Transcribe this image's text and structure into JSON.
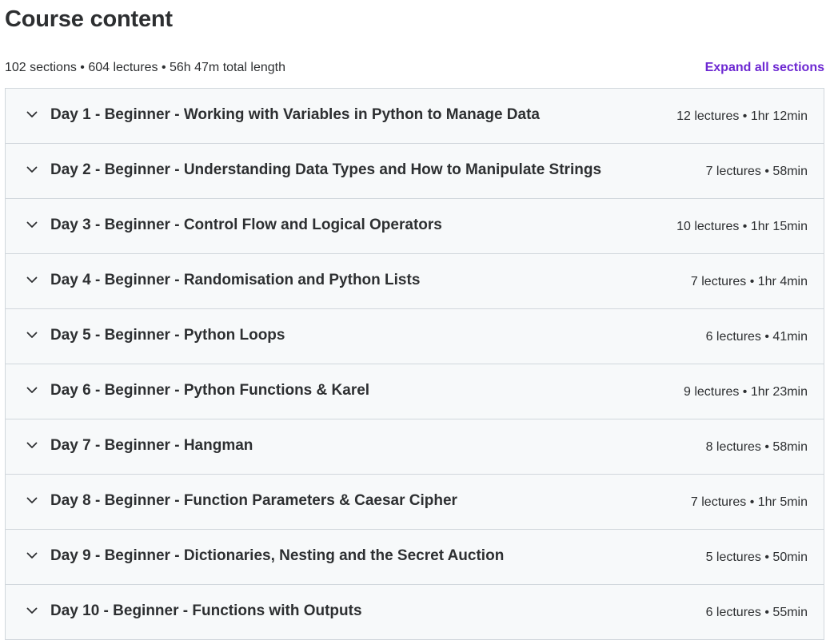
{
  "header": {
    "title": "Course content"
  },
  "summary": {
    "stats": "102 sections • 604 lectures • 56h 47m total length",
    "expand_all_label": "Expand all sections"
  },
  "colors": {
    "accent": "#6d28d2",
    "section_bg": "#f7f9fa",
    "border": "#d1d7dc",
    "text": "#2d2f31"
  },
  "sections": [
    {
      "title": "Day 1 - Beginner - Working with Variables in Python to Manage Data",
      "meta": "12 lectures • 1hr 12min",
      "icon": "chevron-down-icon"
    },
    {
      "title": "Day 2 - Beginner - Understanding Data Types and How to Manipulate Strings",
      "meta": "7 lectures • 58min",
      "icon": "chevron-down-icon"
    },
    {
      "title": "Day 3 - Beginner - Control Flow and Logical Operators",
      "meta": "10 lectures • 1hr 15min",
      "icon": "chevron-down-icon"
    },
    {
      "title": "Day 4 - Beginner - Randomisation and Python Lists",
      "meta": "7 lectures • 1hr 4min",
      "icon": "chevron-down-icon"
    },
    {
      "title": "Day 5 - Beginner - Python Loops",
      "meta": "6 lectures • 41min",
      "icon": "chevron-down-icon"
    },
    {
      "title": "Day 6 - Beginner - Python Functions & Karel",
      "meta": "9 lectures • 1hr 23min",
      "icon": "chevron-down-icon"
    },
    {
      "title": "Day 7 - Beginner - Hangman",
      "meta": "8 lectures • 58min",
      "icon": "chevron-down-icon"
    },
    {
      "title": "Day 8 - Beginner - Function Parameters & Caesar Cipher",
      "meta": "7 lectures • 1hr 5min",
      "icon": "chevron-down-icon"
    },
    {
      "title": "Day 9 - Beginner - Dictionaries, Nesting and the Secret Auction",
      "meta": "5 lectures • 50min",
      "icon": "chevron-down-icon"
    },
    {
      "title": "Day 10 - Beginner - Functions with Outputs",
      "meta": "6 lectures • 55min",
      "icon": "chevron-down-icon"
    }
  ]
}
